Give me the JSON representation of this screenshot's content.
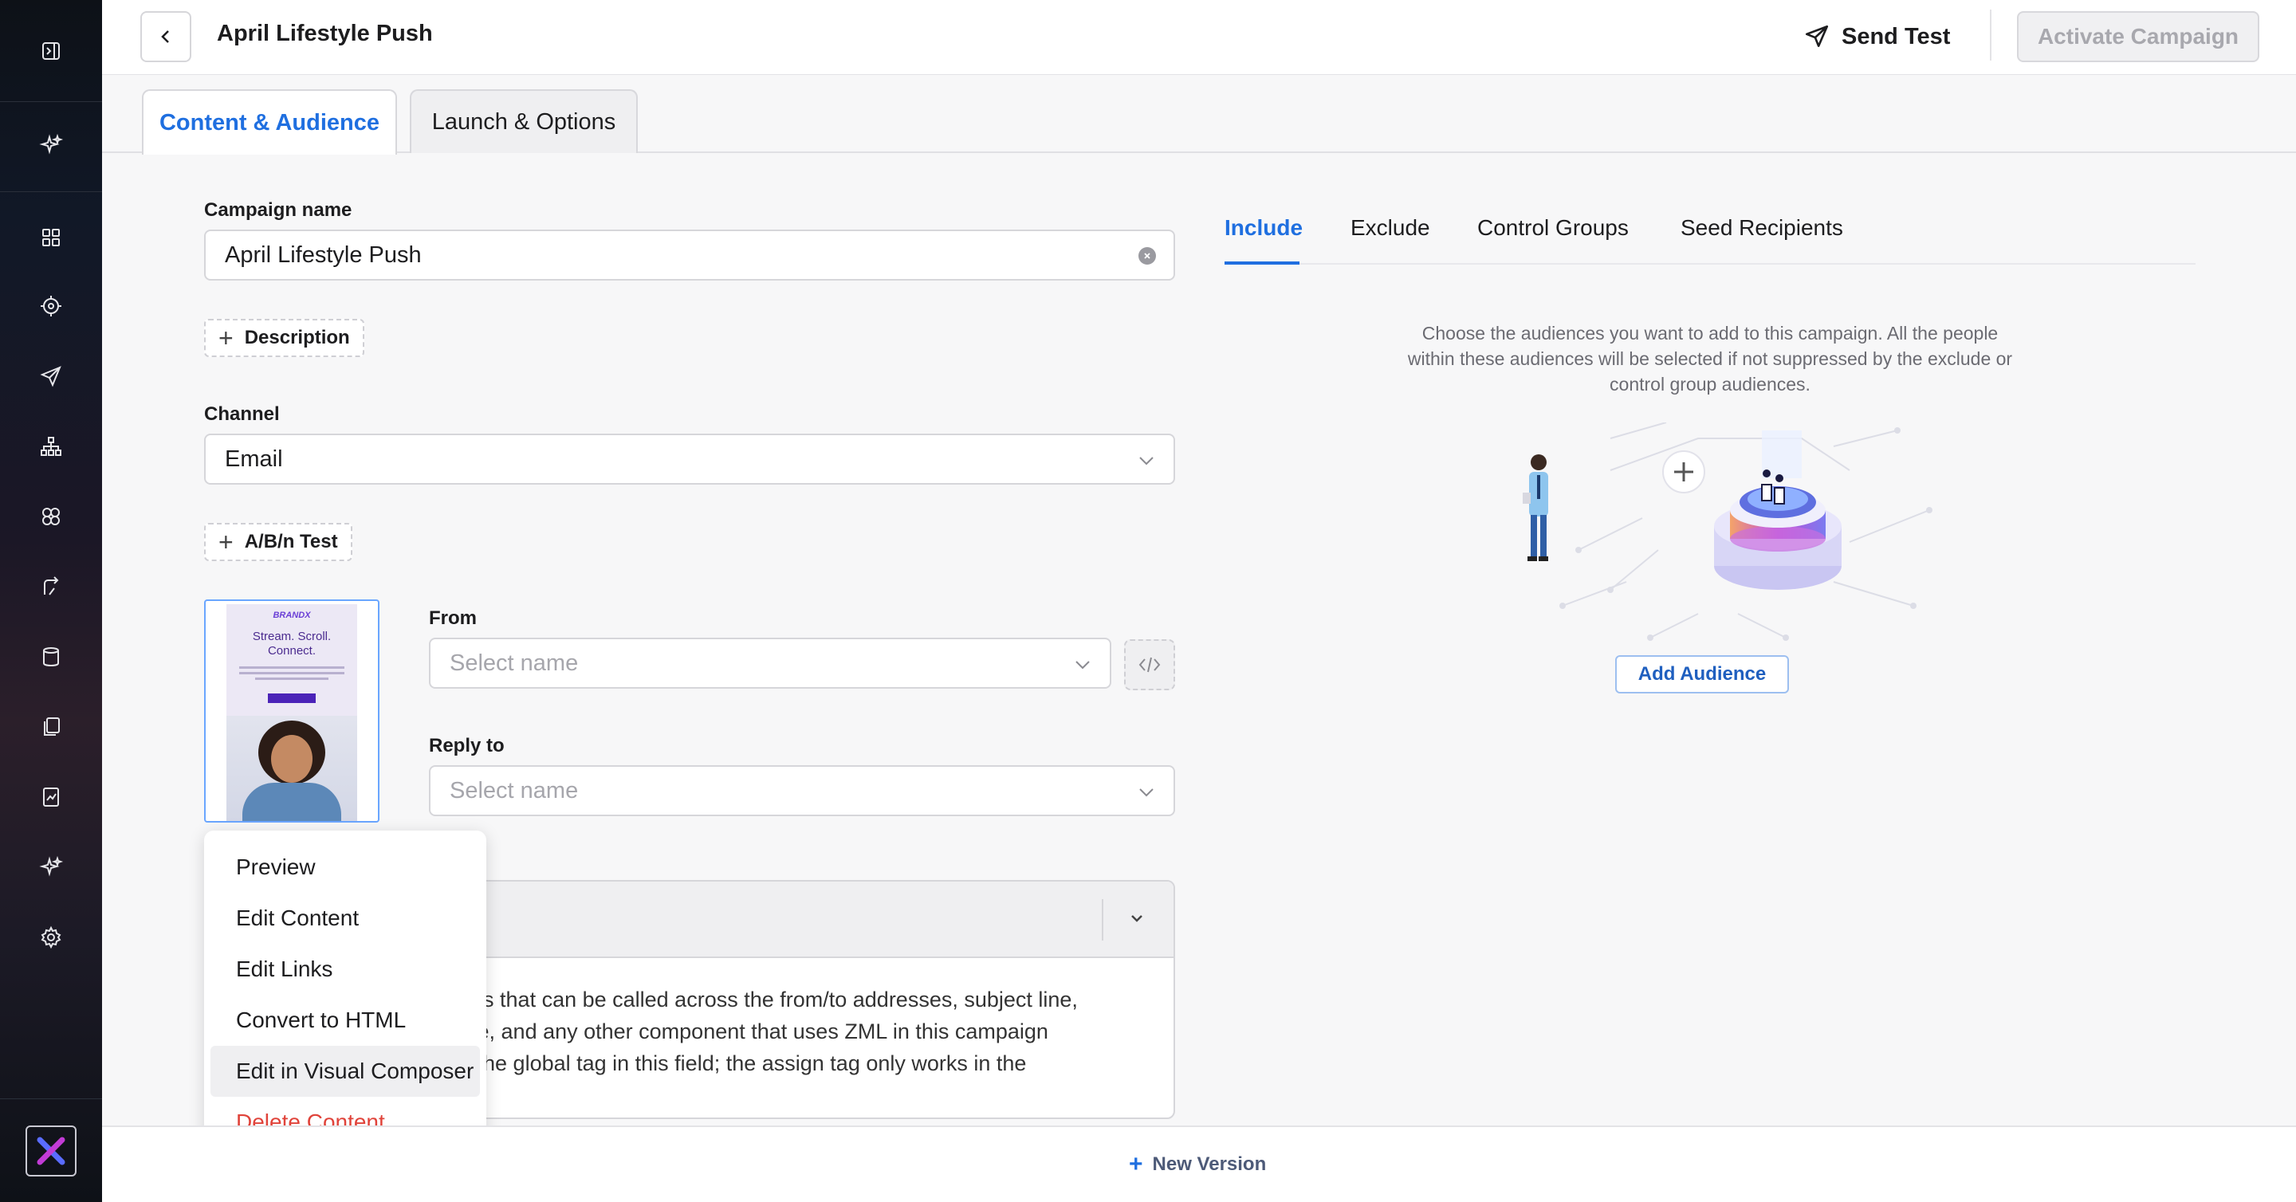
{
  "header": {
    "title": "April Lifestyle Push",
    "send_test": "Send Test",
    "activate": "Activate Campaign"
  },
  "tabs": [
    {
      "label": "Content & Audience"
    },
    {
      "label": "Launch & Options"
    }
  ],
  "form": {
    "campaign_name_label": "Campaign name",
    "campaign_name_value": "April Lifestyle Push",
    "description_btn": "Description",
    "channel_label": "Channel",
    "channel_value": "Email",
    "ab_test_btn": "A/B/n Test",
    "from_label": "From",
    "from_placeholder": "Select name",
    "reply_to_label": "Reply to",
    "reply_to_placeholder": "Select name"
  },
  "thumbnail": {
    "brand": "BRANDX",
    "headline_1": "Stream. Scroll.",
    "headline_2": "Connect."
  },
  "accordion": {
    "body_line_1": "ues that can be called across the from/to addresses, subject line,",
    "body_line_2": "ate, and any other component that uses ZML in this campaign",
    "body_line_3": "e the global tag in this field; the assign tag only works in the"
  },
  "context_menu": {
    "items": [
      {
        "label": "Preview"
      },
      {
        "label": "Edit Content"
      },
      {
        "label": "Edit Links"
      },
      {
        "label": "Convert to HTML"
      },
      {
        "label": "Edit in Visual Composer"
      },
      {
        "label": "Delete Content"
      }
    ]
  },
  "audience": {
    "tabs": [
      {
        "label": "Include"
      },
      {
        "label": "Exclude"
      },
      {
        "label": "Control Groups"
      },
      {
        "label": "Seed Recipients"
      }
    ],
    "hint": "Choose the audiences you want to add to this campaign. All the people within these audiences will be selected if not suppressed by the exclude or control group audiences.",
    "add_button": "Add Audience"
  },
  "footer": {
    "new_version": "New Version"
  },
  "colors": {
    "accent": "#1f6fe0",
    "danger": "#e0433a",
    "sidebar_bg": "#111827"
  },
  "sidebar": {
    "icons": [
      "collapse-icon",
      "sparkle-icon",
      "dashboard-icon",
      "target-icon",
      "send-icon",
      "hierarchy-icon",
      "segments-icon",
      "journey-icon",
      "database-icon",
      "copy-icon",
      "report-icon",
      "ai-icon",
      "settings-icon"
    ]
  }
}
